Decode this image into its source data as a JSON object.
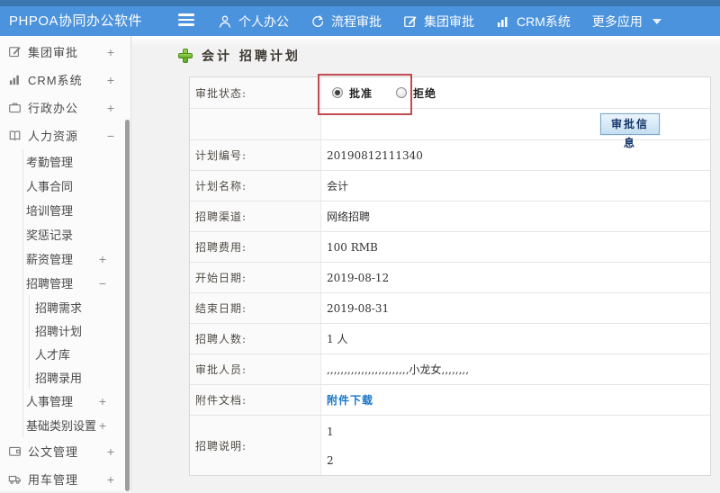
{
  "topbar": {
    "logo": "PHPOA协同办公软件",
    "menu": [
      {
        "label": "个人办公",
        "icon": "person-icon"
      },
      {
        "label": "流程审批",
        "icon": "process-arrow-icon"
      },
      {
        "label": "集团审批",
        "icon": "edit-square-icon"
      },
      {
        "label": "CRM系统",
        "icon": "bar-chart-icon"
      },
      {
        "label": "更多应用",
        "icon": "caret-down-icon"
      }
    ]
  },
  "sidebar": {
    "items": [
      {
        "label": "集团审批",
        "icon": "edit-square-icon",
        "expand": "+"
      },
      {
        "label": "CRM系统",
        "icon": "bar-chart-icon",
        "expand": "+"
      },
      {
        "label": "行政办公",
        "icon": "briefcase-icon",
        "expand": "+"
      },
      {
        "label": "人力资源",
        "icon": "book-icon",
        "expand": "−"
      },
      {
        "label": "考勤管理",
        "expand": ""
      },
      {
        "label": "人事合同",
        "expand": ""
      },
      {
        "label": "培训管理",
        "expand": ""
      },
      {
        "label": "奖惩记录",
        "expand": ""
      },
      {
        "label": "薪资管理",
        "expand": "+"
      },
      {
        "label": "招聘管理",
        "expand": "−"
      },
      {
        "label": "招聘需求",
        "expand": ""
      },
      {
        "label": "招聘计划",
        "expand": ""
      },
      {
        "label": "人才库",
        "expand": ""
      },
      {
        "label": "招聘录用",
        "expand": ""
      },
      {
        "label": "人事管理",
        "expand": "+"
      },
      {
        "label": "基础类别设置",
        "expand": "+"
      },
      {
        "label": "公文管理",
        "icon": "document-icon",
        "expand": "+"
      },
      {
        "label": "用车管理",
        "icon": "truck-icon",
        "expand": "+"
      }
    ]
  },
  "main": {
    "page_title": "会计 招聘计划",
    "approval": {
      "label": "审批状态:",
      "options": [
        {
          "label": "批准",
          "selected": true
        },
        {
          "label": "拒绝",
          "selected": false
        }
      ]
    },
    "approval_info_button": "审批信息",
    "fields": [
      {
        "label": "计划编号:",
        "value": "20190812111340"
      },
      {
        "label": "计划名称:",
        "value": "会计"
      },
      {
        "label": "招聘渠道:",
        "value": "网络招聘"
      },
      {
        "label": "招聘费用:",
        "value": "100 RMB"
      },
      {
        "label": "开始日期:",
        "value": "2019-08-12"
      },
      {
        "label": "结束日期:",
        "value": "2019-08-31"
      },
      {
        "label": "招聘人数:",
        "value": "1 人"
      },
      {
        "label": "审批人员:",
        "value": ",,,,,,,,,,,,,,,,,,,,,,,,小龙女,,,,,,,,"
      },
      {
        "label": "附件文档:",
        "value": "附件下载",
        "link": true
      },
      {
        "label": "招聘说明:",
        "lines": [
          "1",
          "2"
        ]
      }
    ]
  },
  "colors": {
    "topbar_strip": "#3b76b0",
    "topbar": "#4b93dd",
    "accent_green": "#6ab32a",
    "link_blue": "#1a75c6",
    "annotation_red": "#c14b50",
    "button_text_navy": "#16376b",
    "content_bg": "#f2f2f2",
    "sidebar_bg": "#fbfbfb"
  }
}
